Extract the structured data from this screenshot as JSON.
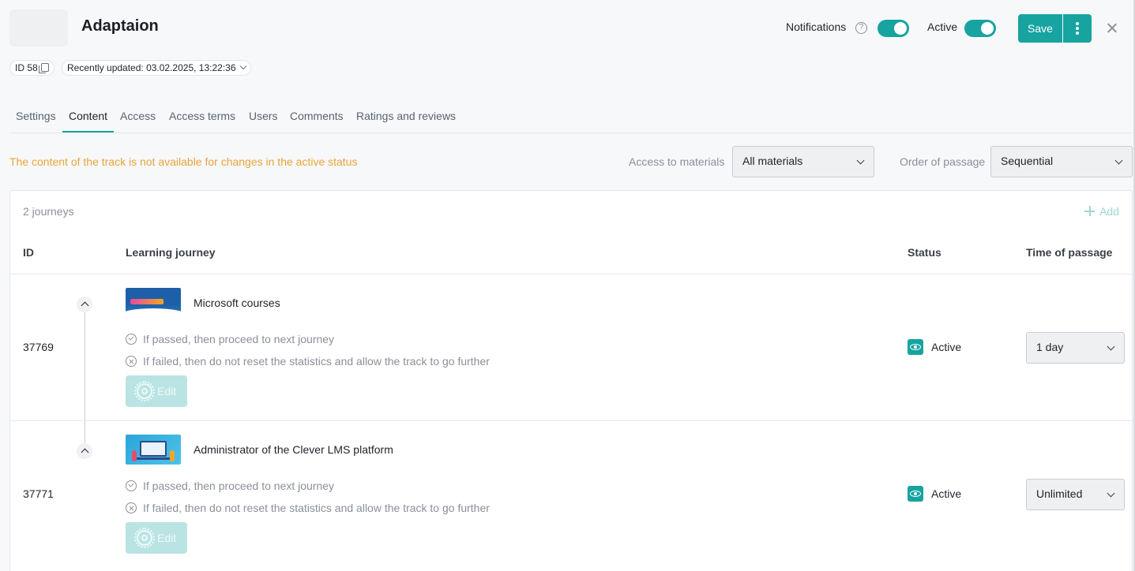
{
  "header": {
    "title": "Adaptaion",
    "notifications_label": "Notifications",
    "notifications_on": true,
    "active_label": "Active",
    "active_on": true,
    "save_label": "Save",
    "help_glyph": "?"
  },
  "meta": {
    "id_label": "ID 58",
    "updated_label": "Recently updated: 03.02.2025, 13:22:36"
  },
  "tabs": [
    {
      "label": "Settings",
      "active": false
    },
    {
      "label": "Content",
      "active": true
    },
    {
      "label": "Access",
      "active": false
    },
    {
      "label": "Access terms",
      "active": false
    },
    {
      "label": "Users",
      "active": false
    },
    {
      "label": "Comments",
      "active": false
    },
    {
      "label": "Ratings and reviews",
      "active": false
    }
  ],
  "content": {
    "warning": "The content of the track is not available for changes in the active status",
    "access_label": "Access to materials",
    "access_value": "All materials",
    "order_label": "Order of passage",
    "order_value": "Sequential"
  },
  "table": {
    "count": "2 journeys",
    "add_label": "Add",
    "columns": {
      "id": "ID",
      "journey": "Learning journey",
      "status": "Status",
      "time": "Time of passage"
    },
    "rows": [
      {
        "id": "37769",
        "title": "Microsoft courses",
        "passed": "If passed, then proceed to next journey",
        "failed": "If failed, then do not reset the statistics and allow the track to go further",
        "edit": "Edit",
        "status": "Active",
        "time": "1 day"
      },
      {
        "id": "37771",
        "title": "Administrator of the Clever LMS platform",
        "passed": "If passed, then proceed to next journey",
        "failed": "If failed, then do not reset the statistics and allow the track to go further",
        "edit": "Edit",
        "status": "Active",
        "time": "Unlimited"
      }
    ]
  },
  "colors": {
    "accent": "#17a3a0",
    "warning": "#e8a43a"
  }
}
